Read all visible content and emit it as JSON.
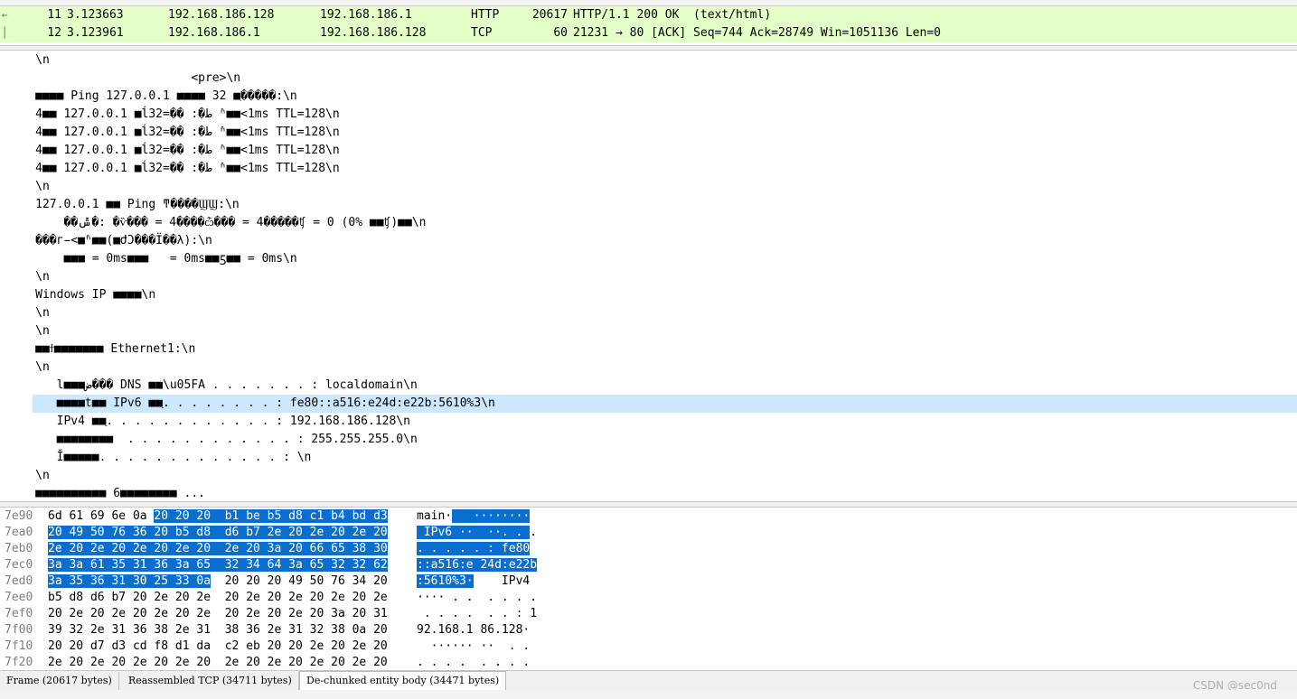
{
  "packets": [
    {
      "no": "11",
      "time": "3.123663",
      "src": "192.168.186.128",
      "dst": "192.168.186.1",
      "proto": "HTTP",
      "len": "20617",
      "info": "HTTP/1.1 200 OK  (text/html)"
    },
    {
      "no": "12",
      "time": "3.123961",
      "src": "192.168.186.1",
      "dst": "192.168.186.128",
      "proto": "TCP",
      "len": "60",
      "info": "21231 → 80 [ACK] Seq=744 Ack=28749 Win=1051136 Len=0"
    }
  ],
  "body_lines": [
    "     \\n",
    "                           <pre>\\n",
    "     ■■■■ Ping 127.0.0.1 ■■■■ 32 ■ֽ�����:\\n",
    "     4■■ 127.0.0.1 ■ĺ32=�� :�ط ʱ■■<1ms TTL=128\\n",
    "     4■■ 127.0.0.1 ■ĺ32=�� :�ط ʱ■■<1ms TTL=128\\n",
    "     4■■ 127.0.0.1 ■ĺ32=�� :�ط ʱ■■<1ms TTL=128\\n",
    "     4■■ 127.0.0.1 ■ĺ32=�� :�ط ʱ■■<1ms TTL=128\\n",
    "     \\n",
    "     127.0.0.1 ■■ Ping ͳ����ϢϢ:\\n",
    "         ��ݰ�: �ѷ��� = 4����ѽ��� = 4�����ʧ = 0 (0% ■■ʧ)■■\\n",
    "     ���г̵<■ʱ■■(■ԺƆ���Ϊ��λ):\\n",
    "         ■■■ = 0ms■■■   = 0ms■■ƽ■■ = 0ms\\n",
    "     \\n",
    "     Windows IP ■■■■\\n",
    "     \\n",
    "     \\n",
    "     ■■ϯ■■■■■■■ Ethernet1:\\n",
    "     \\n",
    "        l■■■ض��� DNS ■■\\u05FA . . . . . . . : localdomain\\n",
    "        ■■■■t■■ IPv6 ■■ַ. . . . . . . . : fe80::a516:e24d:e22b:5610%3\\n",
    "        IPv4 ■■ַ. . . . . . . . . . . . : 192.168.186.128\\n",
    "        ■■■■■■■■  . . . . . . . . . . . . : 255.255.255.0\\n",
    "        Ĭ■■■■■. . . . . . . . . . . . . : \\n",
    "     \\n",
    "     ■■■■■■■■■■ 6■■■■■■■■ ..."
  ],
  "highlight_line": 19,
  "hex_rows": [
    {
      "off": "7e90",
      "bytes": [
        "6d",
        "61",
        "69",
        "6e",
        "0a",
        "20",
        "20",
        "20",
        "b1",
        "be",
        "b5",
        "d8",
        "c1",
        "b4",
        "bd",
        "d3"
      ],
      "sel_from": 5,
      "sel_to": 15,
      "ascii": "main·   ········",
      "ascii_sel_from": 5,
      "ascii_sel_to": 15
    },
    {
      "off": "7ea0",
      "bytes": [
        "20",
        "49",
        "50",
        "76",
        "36",
        "20",
        "b5",
        "d8",
        "d6",
        "b7",
        "2e",
        "20",
        "2e",
        "20",
        "2e",
        "20"
      ],
      "sel_from": 0,
      "sel_to": 15,
      "ascii": " IPv6 ··  ··. . .",
      "ascii_sel_from": 0,
      "ascii_sel_to": 15
    },
    {
      "off": "7eb0",
      "bytes": [
        "2e",
        "20",
        "2e",
        "20",
        "2e",
        "20",
        "2e",
        "20",
        "2e",
        "20",
        "3a",
        "20",
        "66",
        "65",
        "38",
        "30"
      ],
      "sel_from": 0,
      "sel_to": 15,
      "ascii": ". . . . . : fe80",
      "ascii_sel_from": 0,
      "ascii_sel_to": 15
    },
    {
      "off": "7ec0",
      "bytes": [
        "3a",
        "3a",
        "61",
        "35",
        "31",
        "36",
        "3a",
        "65",
        "32",
        "34",
        "64",
        "3a",
        "65",
        "32",
        "32",
        "62"
      ],
      "sel_from": 0,
      "sel_to": 15,
      "ascii": "::a516:e 24d:e22b",
      "ascii_sel_from": 0,
      "ascii_sel_to": 16
    },
    {
      "off": "7ed0",
      "bytes": [
        "3a",
        "35",
        "36",
        "31",
        "30",
        "25",
        "33",
        "0a",
        "20",
        "20",
        "20",
        "49",
        "50",
        "76",
        "34",
        "20"
      ],
      "sel_from": 0,
      "sel_to": 7,
      "ascii": ":5610%3·    IPv4",
      "ascii_sel_from": 0,
      "ascii_sel_to": 7
    },
    {
      "off": "7ee0",
      "bytes": [
        "b5",
        "d8",
        "d6",
        "b7",
        "20",
        "2e",
        "20",
        "2e",
        "20",
        "2e",
        "20",
        "2e",
        "20",
        "2e",
        "20",
        "2e"
      ],
      "sel_from": -1,
      "sel_to": -1,
      "ascii": "···· . .  . . . .",
      "ascii_sel_from": -1,
      "ascii_sel_to": -1
    },
    {
      "off": "7ef0",
      "bytes": [
        "20",
        "2e",
        "20",
        "2e",
        "20",
        "2e",
        "20",
        "2e",
        "20",
        "2e",
        "20",
        "2e",
        "20",
        "3a",
        "20",
        "31"
      ],
      "sel_from": -1,
      "sel_to": -1,
      "ascii": " . . . .  . . : 1",
      "ascii_sel_from": -1,
      "ascii_sel_to": -1
    },
    {
      "off": "7f00",
      "bytes": [
        "39",
        "32",
        "2e",
        "31",
        "36",
        "38",
        "2e",
        "31",
        "38",
        "36",
        "2e",
        "31",
        "32",
        "38",
        "0a",
        "20"
      ],
      "sel_from": -1,
      "sel_to": -1,
      "ascii": "92.168.1 86.128·",
      "ascii_sel_from": -1,
      "ascii_sel_to": -1
    },
    {
      "off": "7f10",
      "bytes": [
        "20",
        "20",
        "d7",
        "d3",
        "cd",
        "f8",
        "d1",
        "da",
        "c2",
        "eb",
        "20",
        "20",
        "2e",
        "20",
        "2e",
        "20"
      ],
      "sel_from": -1,
      "sel_to": -1,
      "ascii": "  ······ ··  . .",
      "ascii_sel_from": -1,
      "ascii_sel_to": -1
    },
    {
      "off": "7f20",
      "bytes": [
        "2e",
        "20",
        "2e",
        "20",
        "2e",
        "20",
        "2e",
        "20",
        "2e",
        "20",
        "2e",
        "20",
        "2e",
        "20",
        "2e",
        "20"
      ],
      "sel_from": -1,
      "sel_to": -1,
      "ascii": ". . . .  . . . .",
      "ascii_sel_from": -1,
      "ascii_sel_to": -1
    }
  ],
  "tabs": [
    {
      "label": "Frame (20617 bytes)",
      "active": false
    },
    {
      "label": "Reassembled TCP (34711 bytes)",
      "active": false
    },
    {
      "label": "De-chunked entity body (34471 bytes)",
      "active": true
    }
  ],
  "watermark": "CSDN @sec0nd_",
  "colors": {
    "packet_row_bg": "#e4ffc7",
    "line_highlight": "#cce8ff",
    "byte_selection": "#0a6ecf"
  },
  "icons": {
    "related_packet_marker": "reply-arrow-icon"
  }
}
